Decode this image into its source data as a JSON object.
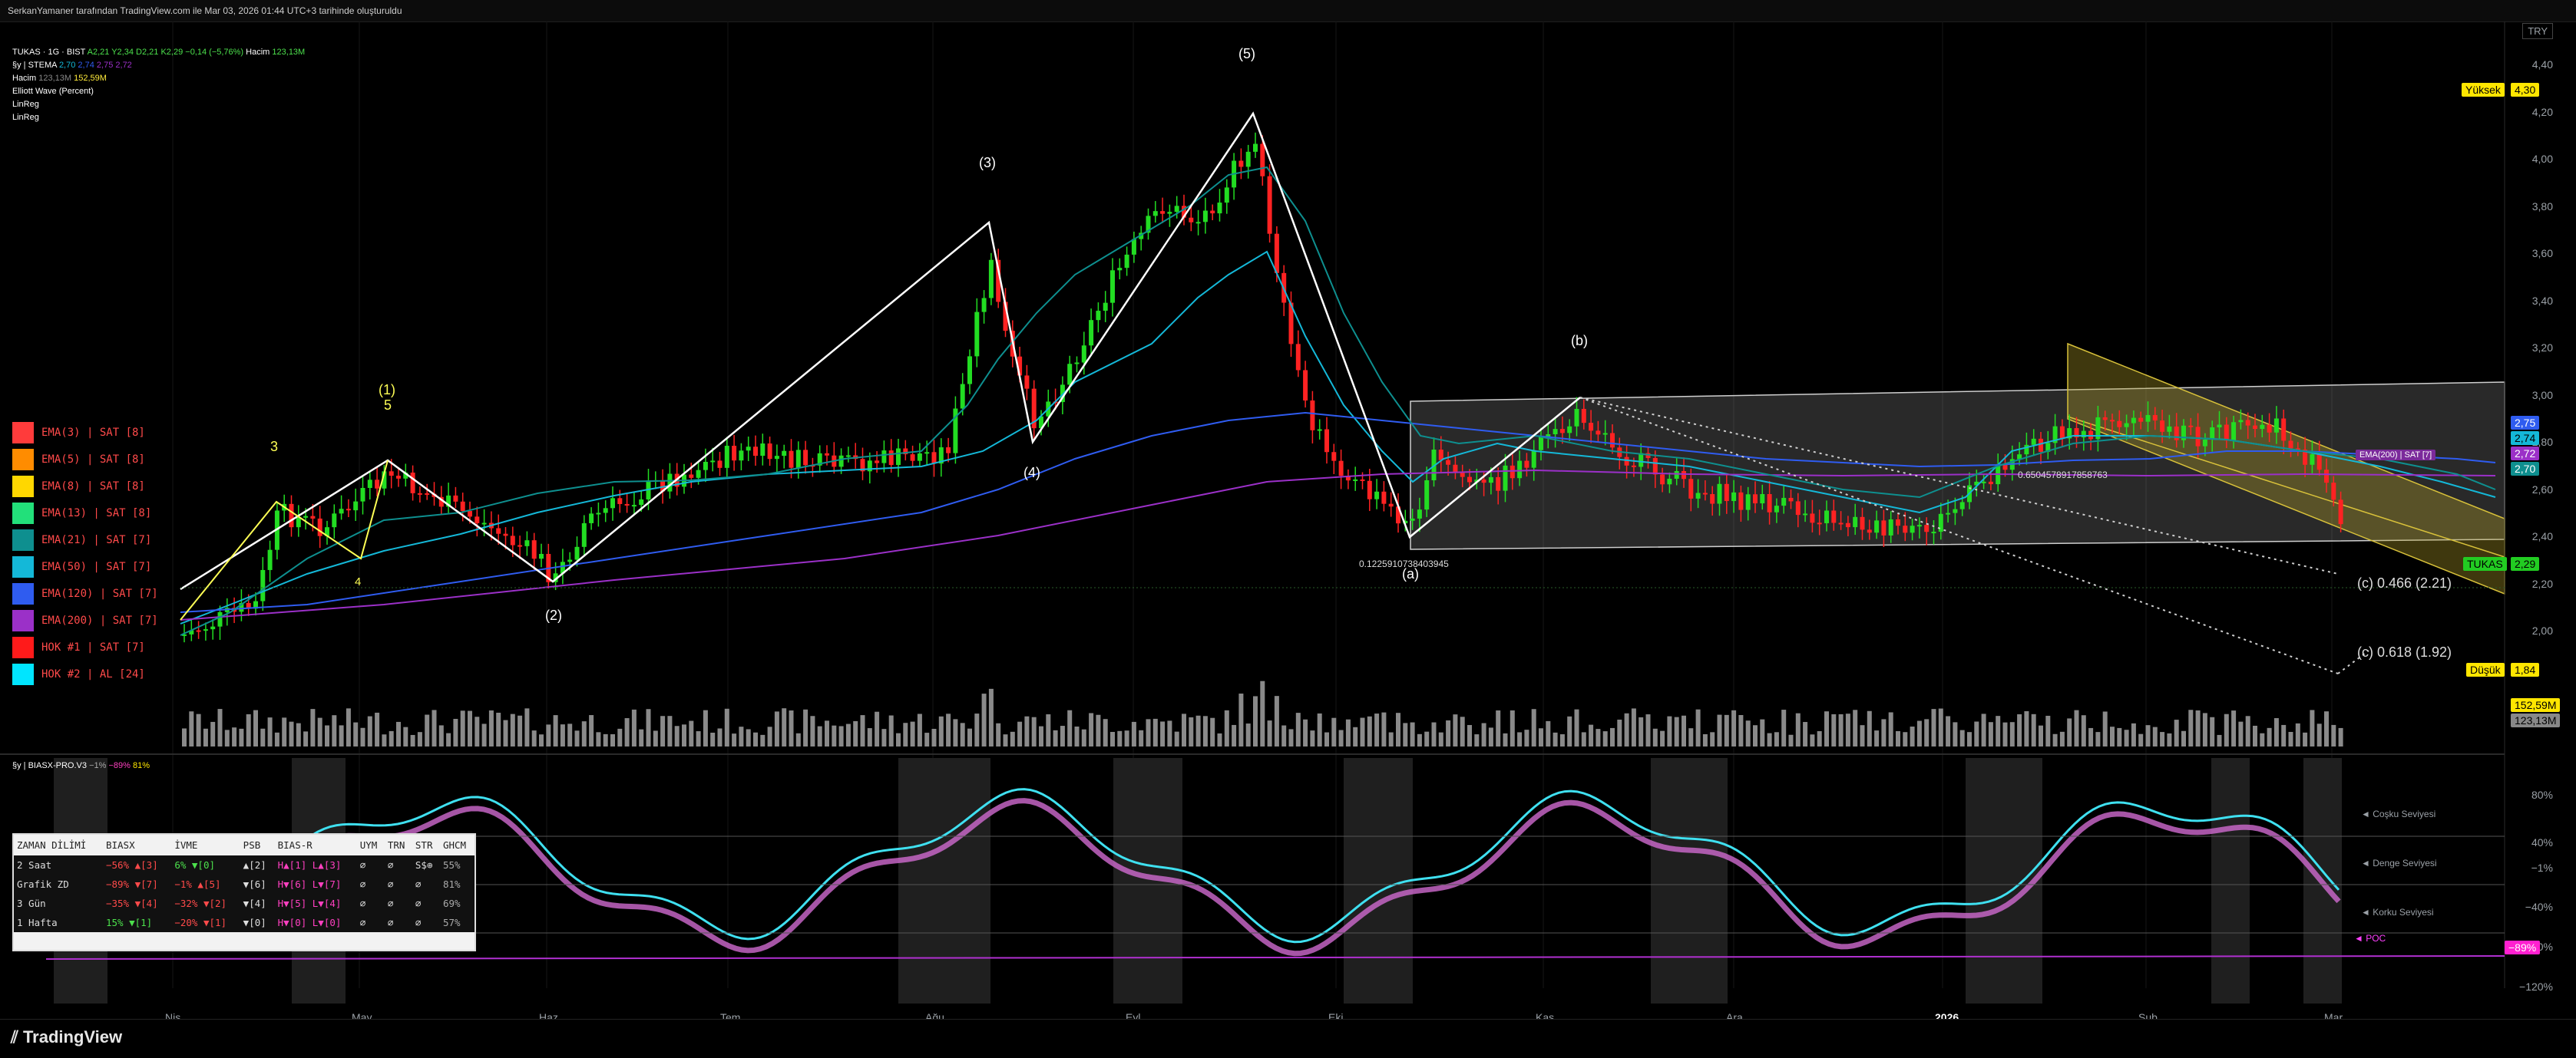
{
  "header": {
    "byline": "SerkanYamaner tarafından TradingView.com ile Mar 03, 2026 01:44 UTC+3 tarihinde oluşturuldu"
  },
  "legend": {
    "symbol_line": "TUKAS · 1G · BIST",
    "ohlc": [
      "A2,21",
      "Y2,34",
      "D2,21",
      "K2,29",
      "−0,14 (−5,76%)",
      "Hacim",
      "123,13M"
    ],
    "stema_line": "§y | STEMA",
    "stema_values": [
      "2,70",
      "2,74",
      "2,75",
      "2,72"
    ],
    "hacim_line": "Hacim",
    "hacim_values": [
      "123,13M",
      "152,59M"
    ],
    "elliott": "Elliott Wave (Percent)",
    "linreg1": "LinReg",
    "linreg2": "LinReg"
  },
  "ema_list": [
    {
      "label": "EMA(3) | SAT [8]",
      "color": "#ff3b3b"
    },
    {
      "label": "EMA(5) | SAT [8]",
      "color": "#ff8c00"
    },
    {
      "label": "EMA(8) | SAT [8]",
      "color": "#ffd700"
    },
    {
      "label": "EMA(13) | SAT [8]",
      "color": "#22e07a"
    },
    {
      "label": "EMA(21) | SAT [7]",
      "color": "#0e8f8f"
    },
    {
      "label": "EMA(50) | SAT [7]",
      "color": "#14b8d8"
    },
    {
      "label": "EMA(120) | SAT [7]",
      "color": "#2f5cf0"
    },
    {
      "label": "EMA(200) | SAT [7]",
      "color": "#9b30c8"
    },
    {
      "label": "HOK #1 | SAT [7]",
      "color": "#ff1a1a"
    },
    {
      "label": "HOK #2 | AL [24]",
      "color": "#00e5ff"
    }
  ],
  "yaxis": {
    "currency": "TRY",
    "ticks": [
      "4,40",
      "4,20",
      "4,00",
      "3,80",
      "3,60",
      "3,40",
      "3,20",
      "3,00",
      "2,80",
      "2,60",
      "2,40",
      "2,20",
      "2,00"
    ],
    "badges": {
      "yuksek": "Yüksek",
      "yuksek_val": "4,30",
      "dusuk": "Düşük",
      "dusuk_val": "1,84",
      "tukas": "TUKAS",
      "tukas_val": "2,29",
      "ema_vals": [
        "2,75",
        "2,74",
        "2,72",
        "2,70"
      ],
      "vol1": "152,59M",
      "vol2": "123,13M"
    }
  },
  "waves": {
    "w1": "(1)",
    "w2": "(2)",
    "w3": "(3)",
    "w4": "(4)",
    "w5": "(5)",
    "wa": "(a)",
    "wb": "(b)",
    "wc1": "(c) 0.466 (2.21)",
    "wc2": "(c) 0.618 (1.92)",
    "sub3": "3",
    "sub4": "4",
    "sub5": "5",
    "fib1": "0.1225910738403945",
    "fib2": "0.6504578917858763",
    "emarow_badge": "EMA(200) | SAT [7]"
  },
  "oscillator": {
    "title": "§y | BIASX-PRO.V3",
    "values": [
      "−1%",
      "−89%",
      "81%"
    ],
    "ticks": [
      "80%",
      "40%",
      "−1%",
      "−40%",
      "−80%",
      "−120%"
    ],
    "levels": [
      "◄ Coşku Seviyesi",
      "◄ Denge Seviyesi",
      "◄ Korku Seviyesi"
    ],
    "poc": "◄ POC",
    "last_badge": "−89%",
    "table": {
      "headers": [
        "ZAMAN DİLİMİ",
        "BIASX",
        "İVME",
        "PSB",
        "BIAS-R",
        "UYM",
        "TRN",
        "STR",
        "GHCM"
      ],
      "rows": [
        [
          "2 Saat",
          "−56% ▲[3]",
          "6% ▼[0]",
          "▲[2]",
          "H▲[1] L▲[3]",
          "⌀",
          "⌀",
          "S$⊕",
          "55%"
        ],
        [
          "Grafik ZD",
          "−89% ▼[7]",
          "−1% ▲[5]",
          "▼[6]",
          "H▼[6] L▼[7]",
          "⌀",
          "⌀",
          "⌀",
          "81%"
        ],
        [
          "3 Gün",
          "−35% ▼[4]",
          "−32% ▼[2]",
          "▼[4]",
          "H▼[5] L▼[4]",
          "⌀",
          "⌀",
          "⌀",
          "69%"
        ],
        [
          "1 Hafta",
          "15% ▼[1]",
          "−20% ▼[1]",
          "▼[0]",
          "H▼[0] L▼[0]",
          "⌀",
          "⌀",
          "⌀",
          "57%"
        ]
      ]
    }
  },
  "xaxis": [
    "Nis",
    "May",
    "Haz",
    "Tem",
    "Ağu",
    "Eyl",
    "Eki",
    "Kas",
    "Ara",
    "2026",
    "Şub",
    "Mar"
  ],
  "footer": {
    "brand": "TradingView"
  },
  "colors": {
    "up": "#22dd22",
    "down": "#ff2222",
    "bg": "#000000"
  }
}
